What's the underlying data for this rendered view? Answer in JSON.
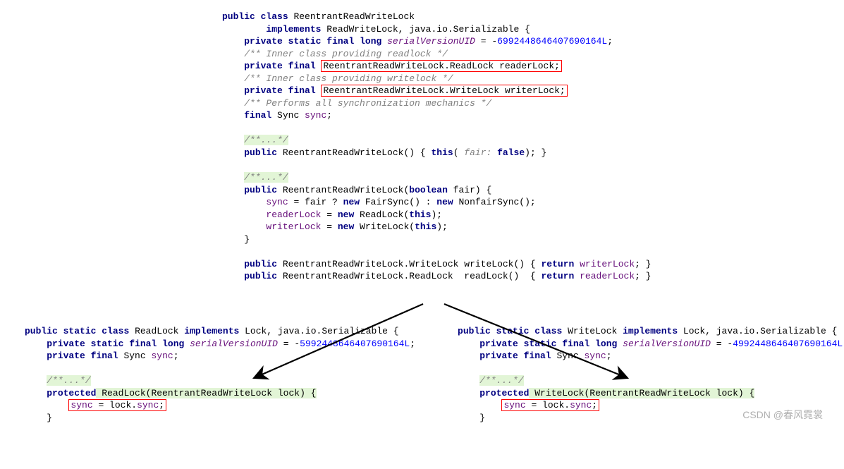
{
  "top": {
    "l1_public": "public",
    "l1_class": "class",
    "l1_name": " ReentrantReadWriteLock",
    "l2_impl": "implements",
    "l2_rest": " ReadWriteLock, java.io.Serializable {",
    "l3_priv": "private",
    "l3_static": "static",
    "l3_final": "final",
    "l3_long": "long",
    "l3_svu": "serialVersionUID",
    "l3_eq": " = ",
    "l3_neg": "-",
    "l3_num": "6992448646407690164L",
    "l3_semi": ";",
    "c_readlock": "/** Inner class providing readlock */",
    "l4_priv": "private",
    "l4_final": "final",
    "l4_box": "ReentrantReadWriteLock.ReadLock readerLock;",
    "c_writelock": "/** Inner class providing writelock */",
    "l5_priv": "private",
    "l5_final": "final",
    "l5_box": "ReentrantReadWriteLock.WriteLock writerLock;",
    "c_sync": "/** Performs all synchronization mechanics */",
    "l6_final": "final",
    "l6_sync": " Sync ",
    "l6_syncvar": "sync",
    "l6_semi": ";",
    "dotsA": "/**...*/",
    "l7_public": "public",
    "l7_sig": " ReentrantReadWriteLock() { ",
    "l7_this": "this",
    "l7_open": "( ",
    "l7_hint": "fair:",
    "l7_sp": " ",
    "l7_false": "false",
    "l7_close": "); }",
    "dotsB": "/**...*/",
    "l8_public": "public",
    "l8_sig": " ReentrantReadWriteLock(",
    "l8_bool": "boolean",
    "l8_rest": " fair) {",
    "l9_sync": "sync",
    "l9_mid": " = fair ? ",
    "l9_new1": "new",
    "l9_fs": " FairSync() : ",
    "l9_new2": "new",
    "l9_nfs": " NonfairSync();",
    "l10_rl": "readerLock",
    "l10_eq": " = ",
    "l10_new": "new",
    "l10_rest": " ReadLock(",
    "l10_this": "this",
    "l10_end": ");",
    "l11_wl": "writerLock",
    "l11_eq": " = ",
    "l11_new": "new",
    "l11_rest": " WriteLock(",
    "l11_this": "this",
    "l11_end": ");",
    "l12_close": "}",
    "l13_public": "public",
    "l13_sig": " ReentrantReadWriteLock.WriteLock writeLock() { ",
    "l13_ret": "return",
    "l13_sp": " ",
    "l13_var": "writerLock",
    "l13_end": "; }",
    "l14_public": "public",
    "l14_sig": " ReentrantReadWriteLock.ReadLock  readLock()  { ",
    "l14_ret": "return",
    "l14_sp": " ",
    "l14_var": "readerLock",
    "l14_end": "; }"
  },
  "left": {
    "l1_p": "public",
    "l1_s": "static",
    "l1_c": "class",
    "l1_name": " ReadLock ",
    "l1_impl": "implements",
    "l1_rest": " Lock, java.io.Serializable {",
    "l2_p": "private",
    "l2_s": "static",
    "l2_f": "final",
    "l2_long": "long",
    "l2_svu": "serialVersionUID",
    "l2_eq": " = ",
    "l2_neg": "-",
    "l2_num": "5992448646407690164L",
    "l2_semi": ";",
    "l3_p": "private",
    "l3_f": "final",
    "l3_rest": " Sync ",
    "l3_sync": "sync",
    "l3_semi": ";",
    "dots": "/**...*/",
    "l4_prot": "protected",
    "l4_sig": " ReadLock(ReentrantReadWriteLock lock) {",
    "l5_box_a": "sync",
    "l5_box_b": " = lock.",
    "l5_box_c": "sync",
    "l5_box_d": ";",
    "l6": "}"
  },
  "right": {
    "l1_p": "public",
    "l1_s": "static",
    "l1_c": "class",
    "l1_name": " WriteLock ",
    "l1_impl": "implements",
    "l1_rest": " Lock, java.io.Serializable {",
    "l2_p": "private",
    "l2_s": "static",
    "l2_f": "final",
    "l2_long": "long",
    "l2_svu": "serialVersionUID",
    "l2_eq": " = ",
    "l2_neg": "-",
    "l2_num": "4992448646407690164L",
    "l2_semi": ";",
    "l3_p": "private",
    "l3_f": "final",
    "l3_rest": " Sync ",
    "l3_sync": "sync",
    "l3_semi": ";",
    "dots": "/**...*/",
    "l4_prot": "protected",
    "l4_sig": " WriteLock(ReentrantReadWriteLock lock) {",
    "l5_box_a": "sync",
    "l5_box_b": " = lock.",
    "l5_box_c": "sync",
    "l5_box_d": ";",
    "l6": "}"
  },
  "watermark": "CSDN @春风霓裳"
}
